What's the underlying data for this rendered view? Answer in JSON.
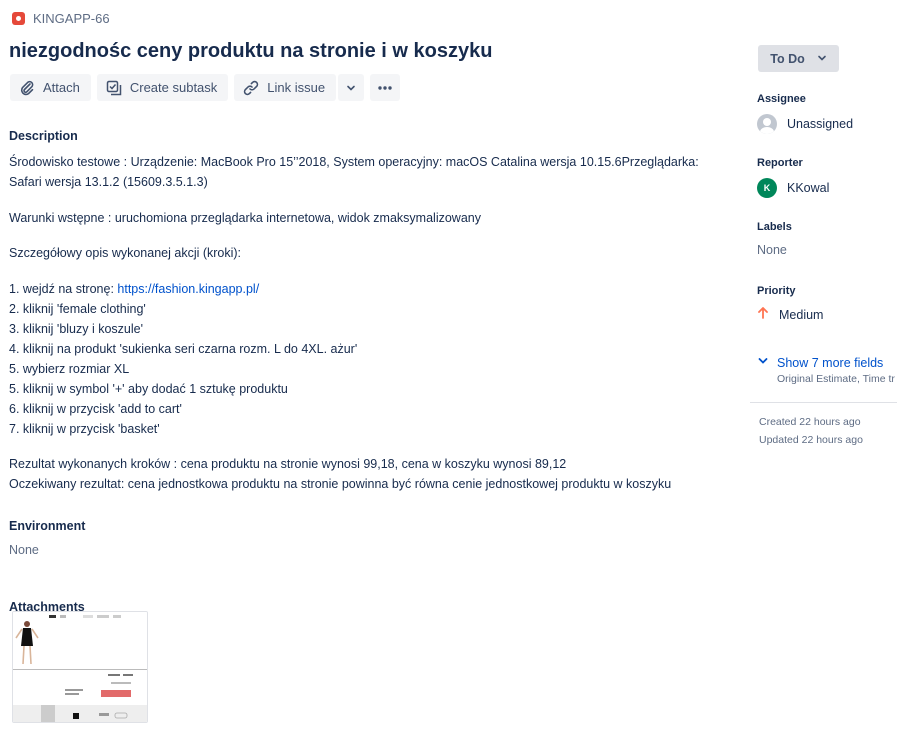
{
  "issue": {
    "key": "KINGAPP-66",
    "title": "niezgodnośc ceny produktu na stronie i w koszyku"
  },
  "toolbar": {
    "attach": "Attach",
    "create_subtask": "Create subtask",
    "link_issue": "Link issue"
  },
  "description": {
    "label": "Description",
    "env_line1": "Środowisko testowe : Urządzenie: MacBook Pro 15’’2018, System operacyjny: macOS Catalina wersja 10.15.6Przeglądarka:",
    "env_line2": "Safari wersja 13.1.2 (15609.3.5.1.3)",
    "preconditions": "Warunki wstępne : uruchomiona przeglądarka internetowa, widok zmaksymalizowany",
    "steps_intro": "Szczegółowy opis wykonanej akcji (kroki):",
    "step1_prefix": "1. wejdź na stronę: ",
    "step1_link": "https://fashion.kingapp.pl/",
    "steps": [
      "2. kliknij 'female clothing'",
      "3. kliknij 'bluzy i koszule'",
      "4. kliknij na produkt 'sukienka seri czarna rozm. L do 4XL. ażur'",
      "5. wybierz rozmiar XL",
      "5. kliknij w symbol '+' aby dodać 1 sztukę produktu",
      "6. kliknij w przycisk 'add to cart'",
      "7. kliknij w przycisk 'basket'"
    ],
    "actual": "Rezultat wykonanych kroków : cena produktu na stronie wynosi 99,18, cena w koszyku wynosi 89,12",
    "expected": "Oczekiwany rezultat: cena jednostkowa produktu na stronie powinna być równa cenie jednostkowej produktu w koszyku"
  },
  "environment": {
    "label": "Environment",
    "value": "None"
  },
  "attachments": {
    "label": "Attachments"
  },
  "sidebar": {
    "status": "To Do",
    "assignee_label": "Assignee",
    "assignee_value": "Unassigned",
    "reporter_label": "Reporter",
    "reporter_initial": "K",
    "reporter_value": "KKowal",
    "labels_label": "Labels",
    "labels_value": "None",
    "priority_label": "Priority",
    "priority_value": "Medium",
    "more_fields": "Show 7 more fields",
    "more_fields_sub": "Original Estimate, Time tr",
    "created": "Created 22 hours ago",
    "updated": "Updated 22 hours ago"
  },
  "colors": {
    "bug": "#e5493a",
    "link": "#0052cc",
    "priority_medium": "#ff7452",
    "reporter_avatar": "#00875a"
  }
}
